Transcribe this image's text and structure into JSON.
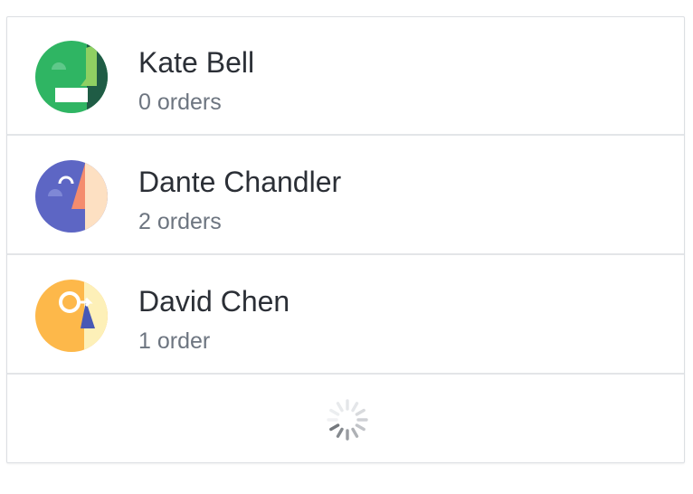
{
  "customers": [
    {
      "name": "Kate Bell",
      "orders": "0 orders",
      "avatar_icon": "abstract-face-green-icon",
      "avatar_color": "#2fb563"
    },
    {
      "name": "Dante Chandler",
      "orders": "2 orders",
      "avatar_icon": "abstract-face-purple-icon",
      "avatar_color": "#5d66c4"
    },
    {
      "name": "David Chen",
      "orders": "1 order",
      "avatar_icon": "abstract-face-yellow-icon",
      "avatar_color": "#fdb84a"
    }
  ],
  "loader": {
    "icon": "loading-spinner-icon"
  }
}
